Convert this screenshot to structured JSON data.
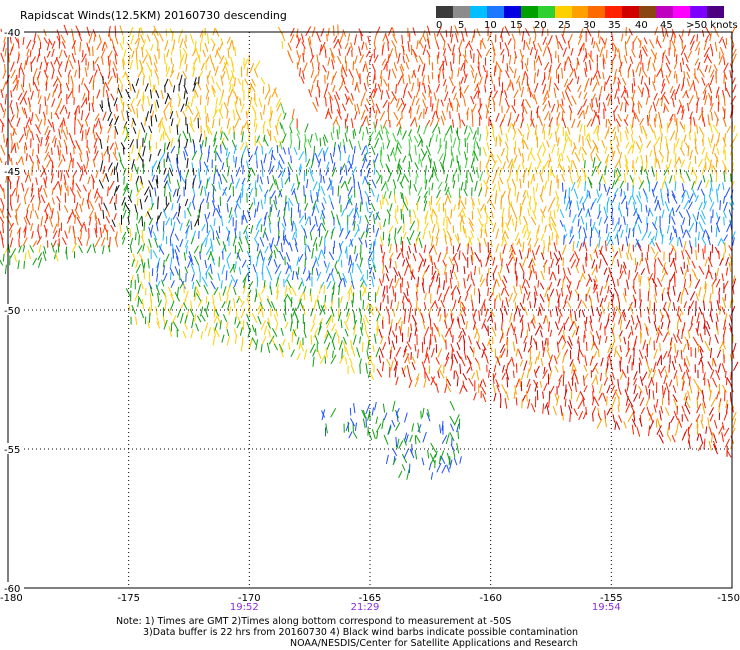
{
  "header": {
    "title": "Rapidscat Winds(12.5KM) 20160730 descending"
  },
  "colorbar": {
    "labels": [
      "0",
      "5",
      "10",
      "15",
      "20",
      "25",
      "30",
      "35",
      "40",
      "45",
      ">50 knots"
    ],
    "colors": [
      "#3a3a3a",
      "#8c8c8c",
      "#00bfff",
      "#1e78ff",
      "#0000e0",
      "#00a000",
      "#30d030",
      "#ffd000",
      "#ffa000",
      "#ff6a00",
      "#ff2000",
      "#d00000",
      "#8b4513",
      "#c000c0",
      "#ff00ff",
      "#7b00ff",
      "#4b0082"
    ]
  },
  "map": {
    "lat_labels": [
      "-40",
      "-45",
      "-50",
      "-55",
      "-60"
    ],
    "lon_labels": [
      "-180",
      "-175",
      "-170",
      "-165",
      "-160",
      "-155",
      "-150"
    ],
    "pass_times": [
      {
        "time": "19:52",
        "lon": -170
      },
      {
        "time": "21:29",
        "lon": -165
      },
      {
        "time": "19:54",
        "lon": -155
      }
    ]
  },
  "notes": {
    "line1": "Note: 1) Times are GMT 2)Times along bottom correspond to measurement at -50S",
    "line2": "3)Data buffer is 22 hrs from 20160730 4) Black wind barbs indicate possible contamination",
    "line3": "NOAA/NESDIS/Center for Satellite Applications and Research"
  }
}
